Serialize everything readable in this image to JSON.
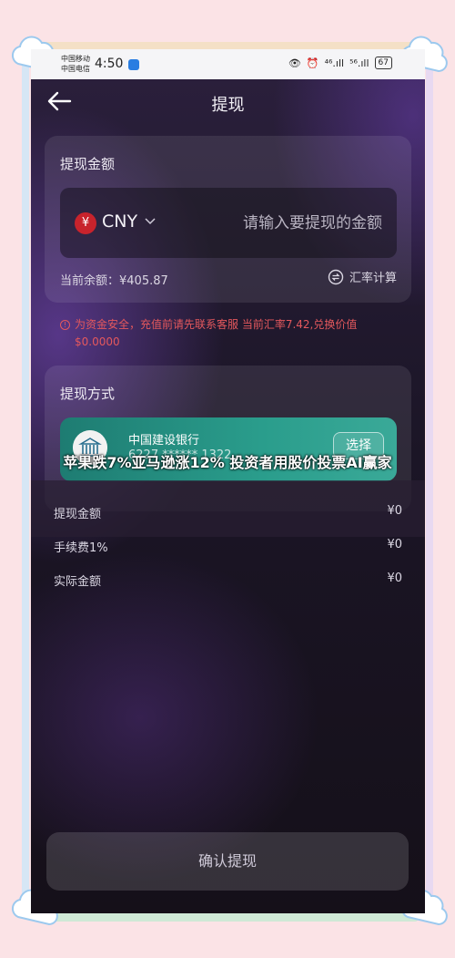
{
  "statusbar": {
    "carrier1": "中国移动",
    "carrier2": "中国电信",
    "time": "4:50",
    "signal1": "⁴⁶.ıll",
    "signal2": "⁵⁶.ıll",
    "battery": "67"
  },
  "header": {
    "title": "提现"
  },
  "amount_section": {
    "label": "提现金额",
    "currency_symbol": "¥",
    "currency": "CNY",
    "placeholder": "请输入要提现的金额",
    "balance": "当前余额：¥405.87",
    "rate_calc": "汇率计算"
  },
  "notice": "为资金安全，充值前请先联系客服 当前汇率7.42,兑换价值$0.0000",
  "method_section": {
    "label": "提现方式",
    "bank_name": "中国建设银行",
    "bank_number": "6227 ****** 1322",
    "select_label": "选择"
  },
  "overlay_caption": "苹果跌7%亚马逊涨12% 投资者用股价投票AI赢家",
  "summary": [
    {
      "label": "提现金额",
      "value": "¥0"
    },
    {
      "label": "手续费1%",
      "value": "¥0"
    },
    {
      "label": "实际金额",
      "value": "¥0"
    }
  ],
  "confirm_label": "确认提现",
  "colors": {
    "accent": "#c8232c",
    "bank_card": "#2a9d8c",
    "notice": "#e4585d"
  }
}
